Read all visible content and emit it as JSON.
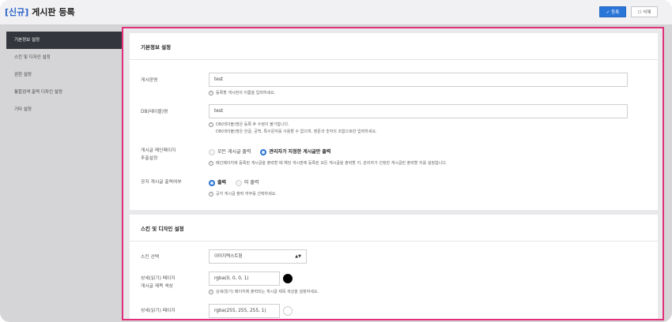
{
  "header": {
    "title_tag": "[신규]",
    "title_text": "게시판 등록",
    "save_label": "✓ 등록",
    "delete_label": "☐ 삭제"
  },
  "sidebar": {
    "items": [
      {
        "label": "기본정보 설정"
      },
      {
        "label": "스킨 및 디자인 설정"
      },
      {
        "label": "권한 설정"
      },
      {
        "label": "통합검색 출력 디자인 설정"
      },
      {
        "label": "기타 설정"
      }
    ]
  },
  "basic": {
    "section_title": "기본정보 설정",
    "board_name_label": "게시판명",
    "board_name_value": "test",
    "board_name_help": "등록할 게시판의 이름을 입력하세요.",
    "db_name_label": "DB(테이블)명",
    "db_name_value": "test",
    "db_help_1": "DB(테이블)명은 등록 후 수정이 불가합니다.",
    "db_help_2": "DB(테이블)명은 한글, 공백, 특수문자를 사용할 수 없으며, 영문과 숫자의 조합으로만 입력하세요.",
    "main_output_label_1": "게시글 메인페이지",
    "main_output_label_2": "추출설정",
    "main_output_options": [
      "모든 게시글 출력",
      "관리자가 지정한 게시글만 출력"
    ],
    "main_output_selected": 1,
    "main_output_help": "메인페이지에 등록된 게시글을 출력할 때 해당 게시판에 등록된 모든 게시글을 출력할 지, 관리자가 선정한 게시글만 출력할 지를 설정합니다.",
    "notice_label": "공지 게시글 출력여부",
    "notice_options": [
      "출력",
      "미 출력"
    ],
    "notice_selected": 0,
    "notice_help": "공지 게시글 출력 여부를 선택하세요."
  },
  "skin": {
    "section_title": "스킨 및 디자인 설정",
    "skin_label": "스킨 선택",
    "skin_value": "이미지텍스트형",
    "title_color_label_1": "상세(읽기) 페이지",
    "title_color_label_2": "게시글 제목 색상",
    "title_color_value": "rgba(0, 0, 0, 1)",
    "title_color_swatch": "#000000",
    "title_color_help": "상세(읽기) 페이지에 출력되는 게시글 제목 색상을 설정하세요.",
    "bg_color_label": "상세(읽기) 페이지",
    "bg_color_value": "rgba(255, 255, 255, 1)",
    "bg_color_swatch": "#ffffff"
  },
  "colors": {
    "accent": "#2a75d8",
    "highlight_border": "#e0307a",
    "sidebar_active": "#33373d"
  }
}
